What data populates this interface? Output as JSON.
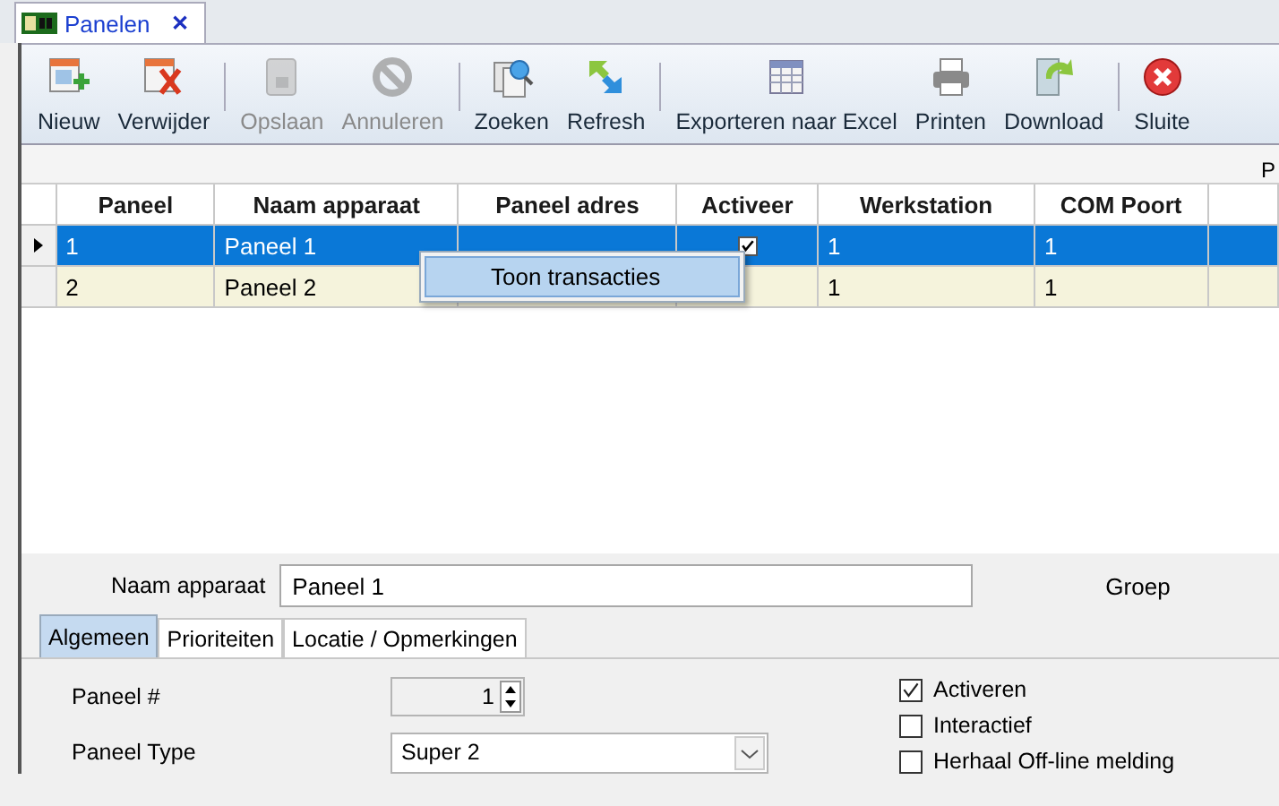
{
  "document_tab": {
    "title": "Panelen",
    "close": "✕"
  },
  "toolbar": {
    "groups": [
      [
        {
          "label": "Nieuw",
          "kind": "new",
          "disabled": false
        },
        {
          "label": "Verwijder",
          "kind": "delete",
          "disabled": false
        }
      ],
      [
        {
          "label": "Opslaan",
          "kind": "save",
          "disabled": true
        },
        {
          "label": "Annuleren",
          "kind": "cancel",
          "disabled": true
        }
      ],
      [
        {
          "label": "Zoeken",
          "kind": "search",
          "disabled": false
        },
        {
          "label": "Refresh",
          "kind": "refresh",
          "disabled": false
        }
      ],
      [
        {
          "label": "Exporteren naar Excel",
          "kind": "export",
          "disabled": false
        },
        {
          "label": "Printen",
          "kind": "print",
          "disabled": false
        },
        {
          "label": "Download",
          "kind": "download",
          "disabled": false
        }
      ],
      [
        {
          "label": "Sluite",
          "kind": "close",
          "disabled": false
        }
      ]
    ]
  },
  "panel_header": "P",
  "grid": {
    "columns": [
      "Paneel",
      "Naam apparaat",
      "Paneel adres",
      "Activeer",
      "Werkstation",
      "COM Poort"
    ],
    "rows": [
      {
        "selected": true,
        "cells": [
          {
            "kind": "text",
            "text": "1"
          },
          {
            "kind": "text",
            "text": "Paneel 1"
          },
          {
            "kind": "covered"
          },
          {
            "kind": "check",
            "checked": true
          },
          {
            "kind": "text",
            "text": "1"
          },
          {
            "kind": "text",
            "text": "1"
          }
        ]
      },
      {
        "selected": false,
        "cells": [
          {
            "kind": "text",
            "text": "2"
          },
          {
            "kind": "text",
            "text": "Paneel 2"
          },
          {
            "kind": "covered"
          },
          {
            "kind": "covered"
          },
          {
            "kind": "text",
            "text": "1"
          },
          {
            "kind": "text",
            "text": "1"
          }
        ]
      }
    ]
  },
  "context_menu": {
    "items": [
      {
        "label": "Toon transacties",
        "selected": true
      }
    ]
  },
  "details": {
    "name_field": {
      "label": "Naam apparaat",
      "value": "Paneel 1"
    },
    "group_label": "Groep",
    "tabs": [
      {
        "label": "Algemeen",
        "selected": true
      },
      {
        "label": "Prioriteiten",
        "selected": false
      },
      {
        "label": "Locatie / Opmerkingen",
        "selected": false
      }
    ],
    "fields": [
      {
        "kind": "spinner",
        "label": "Paneel #",
        "value": "1"
      },
      {
        "kind": "combo",
        "label": "Paneel Type",
        "value": "Super 2"
      }
    ],
    "checkboxes": [
      {
        "label": "Activeren",
        "checked": true
      },
      {
        "label": "Interactief",
        "checked": false
      },
      {
        "label": "Herhaal Off-line melding",
        "checked": false
      }
    ]
  }
}
